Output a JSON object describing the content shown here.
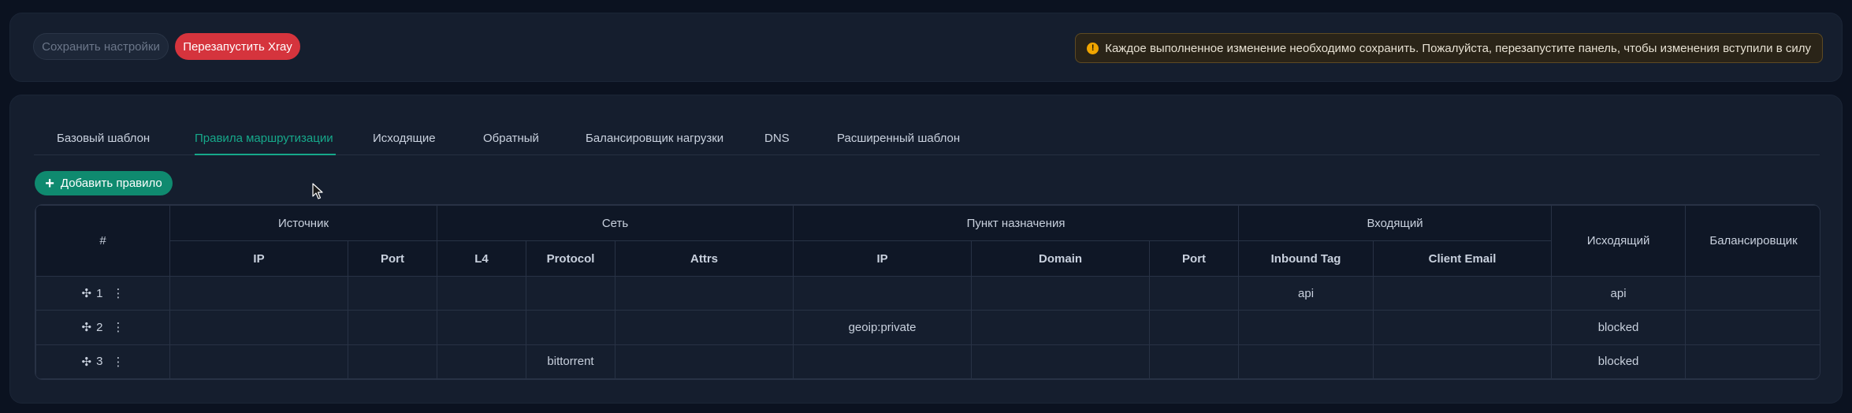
{
  "toolbar": {
    "save_label": "Сохранить настройки",
    "restart_label": "Перезапустить Xray",
    "alert_text": "Каждое выполненное изменение необходимо сохранить. Пожалуйста, перезапустите панель, чтобы изменения вступили в силу",
    "alert_icon": "warning-icon",
    "alert_icon_glyph": "!"
  },
  "tabs": [
    {
      "label": "Базовый шаблон",
      "active": false
    },
    {
      "label": "Правила маршрутизации",
      "active": true
    },
    {
      "label": "Исходящие",
      "active": false
    },
    {
      "label": "Обратный",
      "active": false
    },
    {
      "label": "Балансировщик нагрузки",
      "active": false
    },
    {
      "label": "DNS",
      "active": false
    },
    {
      "label": "Расширенный шаблон",
      "active": false
    }
  ],
  "add_rule": {
    "icon": "+",
    "label": "Добавить правило"
  },
  "table": {
    "groups": {
      "num": "#",
      "source": "Источник",
      "network": "Сеть",
      "destination": "Пункт назначения",
      "inbound": "Входящий",
      "outbound": "Исходящий",
      "balancer": "Балансировщик"
    },
    "columns": {
      "src_ip": "IP",
      "src_port": "Port",
      "l4": "L4",
      "protocol": "Protocol",
      "attrs": "Attrs",
      "dst_ip": "IP",
      "domain": "Domain",
      "dst_port": "Port",
      "inbound_tag": "Inbound Tag",
      "client_email": "Client Email"
    },
    "rows": [
      {
        "num": "1",
        "src_ip": "",
        "src_port": "",
        "l4": "",
        "protocol": "",
        "attrs": "",
        "dst_ip": "",
        "domain": "",
        "dst_port": "",
        "inbound_tag": "api",
        "client_email": "",
        "outbound": "api",
        "balancer": ""
      },
      {
        "num": "2",
        "src_ip": "",
        "src_port": "",
        "l4": "",
        "protocol": "",
        "attrs": "",
        "dst_ip": "geoip:private",
        "domain": "",
        "dst_port": "",
        "inbound_tag": "",
        "client_email": "",
        "outbound": "blocked",
        "balancer": ""
      },
      {
        "num": "3",
        "src_ip": "",
        "src_port": "",
        "l4": "",
        "protocol": "bittorrent",
        "attrs": "",
        "dst_ip": "",
        "domain": "",
        "dst_port": "",
        "inbound_tag": "",
        "client_email": "",
        "outbound": "blocked",
        "balancer": ""
      }
    ],
    "move_glyph": "✣",
    "menu_glyph": "⋮"
  },
  "colors": {
    "accent": "#16a88a",
    "danger": "#d5343d",
    "warning": "#f0a500"
  }
}
